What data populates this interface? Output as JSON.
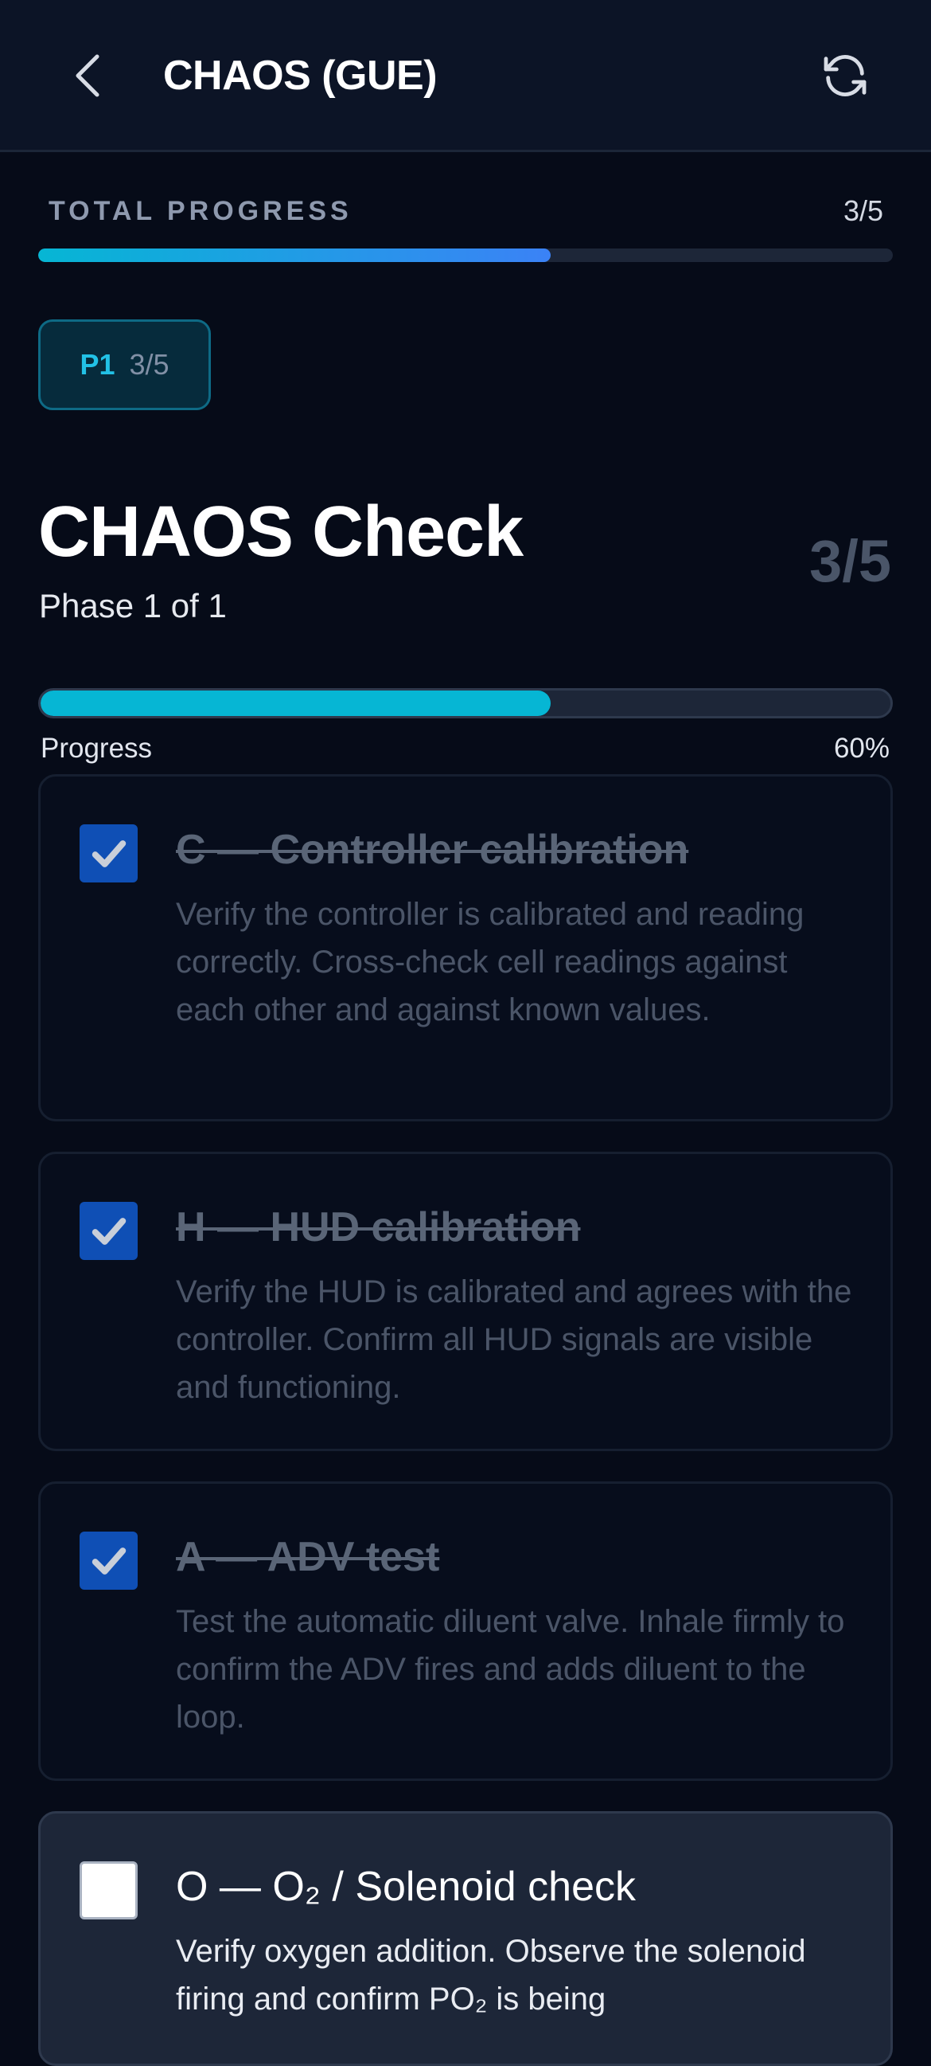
{
  "header": {
    "title": "CHAOS (GUE)",
    "back_icon": "chevron-left-icon",
    "refresh_icon": "refresh-icon"
  },
  "total_progress": {
    "label": "TOTAL PROGRESS",
    "count": "3/5",
    "value": 0.6
  },
  "phase_chip": {
    "name": "P1",
    "count": "3/5"
  },
  "check": {
    "title": "CHAOS Check",
    "subtitle": "Phase 1 of 1",
    "count": "3/5"
  },
  "phase_progress": {
    "label": "Progress",
    "percent": "60%",
    "value": 0.6
  },
  "items": [
    {
      "title": "C — Controller calibration",
      "description": "Verify the controller is calibrated and reading correctly. Cross-check cell readings against each other and against known values.",
      "checked": true
    },
    {
      "title": "H — HUD calibration",
      "description": "Verify the HUD is calibrated and agrees with the controller. Confirm all HUD signals are visible and functioning.",
      "checked": true
    },
    {
      "title": "A — ADV test",
      "description": "Test the automatic diluent valve. Inhale firmly to confirm the ADV fires and adds diluent to the loop.",
      "checked": true
    },
    {
      "title": "O — O₂ / Solenoid check",
      "description": "Verify oxygen addition. Observe the solenoid firing and confirm PO₂ is being",
      "checked": false
    }
  ],
  "colors": {
    "background": "#060b18",
    "accent": "#06b6d4",
    "accent_blue": "#3b82f6",
    "checkbox_checked": "#0f4fb5"
  }
}
